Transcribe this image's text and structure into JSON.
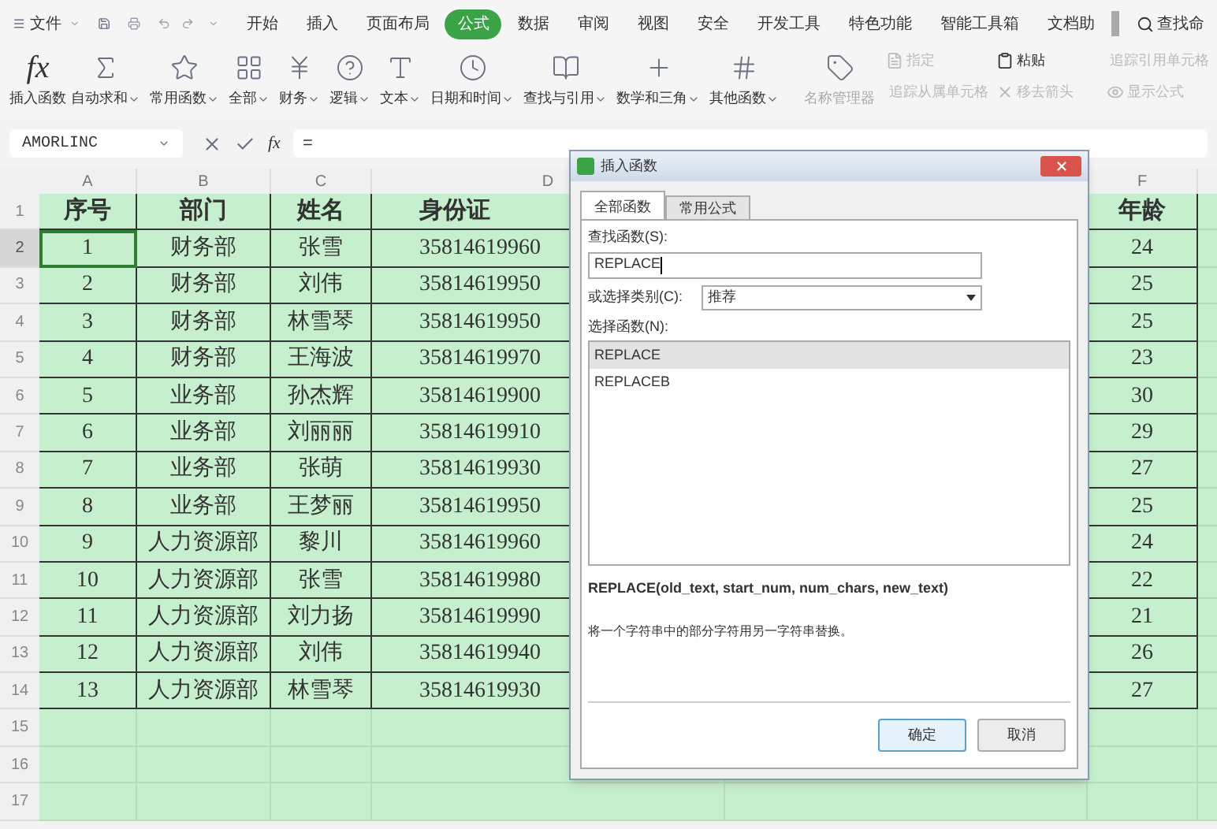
{
  "menu_bar": {
    "file_menu": "文件",
    "tabs": [
      {
        "label": "开始",
        "selected": false
      },
      {
        "label": "插入",
        "selected": false
      },
      {
        "label": "页面布局",
        "selected": false
      },
      {
        "label": "公式",
        "selected": true
      },
      {
        "label": "数据",
        "selected": false
      },
      {
        "label": "审阅",
        "selected": false
      },
      {
        "label": "视图",
        "selected": false
      },
      {
        "label": "安全",
        "selected": false
      },
      {
        "label": "开发工具",
        "selected": false
      },
      {
        "label": "特色功能",
        "selected": false
      },
      {
        "label": "智能工具箱",
        "selected": false
      },
      {
        "label": "文档助",
        "selected": false
      }
    ],
    "search": "查找命"
  },
  "ribbon": {
    "insert_function": {
      "icon_text": "fx",
      "label": "插入函数"
    },
    "buttons": [
      {
        "label": "自动求和",
        "dropdown": true
      },
      {
        "label": "常用函数",
        "dropdown": true
      },
      {
        "label": "全部",
        "dropdown": true
      },
      {
        "label": "财务",
        "dropdown": true
      },
      {
        "label": "逻辑",
        "dropdown": true
      },
      {
        "label": "文本",
        "dropdown": true
      },
      {
        "label": "日期和时间",
        "dropdown": true
      },
      {
        "label": "查找与引用",
        "dropdown": true
      },
      {
        "label": "数学和三角",
        "dropdown": true
      },
      {
        "label": "其他函数",
        "dropdown": true
      },
      {
        "label": "名称管理器",
        "dropdown": false
      }
    ],
    "small_buttons": [
      {
        "label": "指定",
        "disabled": true
      },
      {
        "label": "粘贴",
        "disabled": false
      },
      {
        "label": "追踪引用单元格",
        "disabled": true
      },
      {
        "label": "追踪从属单元格",
        "disabled": true
      },
      {
        "label": "移去箭头",
        "disabled": true
      },
      {
        "label": "显示公式",
        "disabled": true
      }
    ]
  },
  "formula_bar": {
    "name_box": "AMORLINC",
    "fx": "fx",
    "formula": "="
  },
  "sheet": {
    "columns": [
      "A",
      "B",
      "C",
      "D",
      "F"
    ],
    "rows": [
      {
        "number": "1",
        "selected": false,
        "cells": [
          "序号",
          "部门",
          "姓名",
          "身份证",
          "年龄"
        ]
      },
      {
        "number": "2",
        "selected": true,
        "cells": [
          "1",
          "财务部",
          "张雪",
          "35814619960",
          "24"
        ]
      },
      {
        "number": "3",
        "selected": false,
        "cells": [
          "2",
          "财务部",
          "刘伟",
          "35814619950",
          "25"
        ]
      },
      {
        "number": "4",
        "selected": false,
        "cells": [
          "3",
          "财务部",
          "林雪琴",
          "35814619950",
          "25"
        ]
      },
      {
        "number": "5",
        "selected": false,
        "cells": [
          "4",
          "财务部",
          "王海波",
          "35814619970",
          "23"
        ]
      },
      {
        "number": "6",
        "selected": false,
        "cells": [
          "5",
          "业务部",
          "孙杰辉",
          "35814619900",
          "30"
        ]
      },
      {
        "number": "7",
        "selected": false,
        "cells": [
          "6",
          "业务部",
          "刘丽丽",
          "35814619910",
          "29"
        ]
      },
      {
        "number": "8",
        "selected": false,
        "cells": [
          "7",
          "业务部",
          "张萌",
          "35814619930",
          "27"
        ]
      },
      {
        "number": "9",
        "selected": false,
        "cells": [
          "8",
          "业务部",
          "王梦丽",
          "35814619950",
          "25"
        ]
      },
      {
        "number": "10",
        "selected": false,
        "cells": [
          "9",
          "人力资源部",
          "黎川",
          "35814619960",
          "24"
        ]
      },
      {
        "number": "11",
        "selected": false,
        "cells": [
          "10",
          "人力资源部",
          "张雪",
          "35814619980",
          "22"
        ]
      },
      {
        "number": "12",
        "selected": false,
        "cells": [
          "11",
          "人力资源部",
          "刘力扬",
          "35814619990",
          "21"
        ]
      },
      {
        "number": "13",
        "selected": false,
        "cells": [
          "12",
          "人力资源部",
          "刘伟",
          "35814619940",
          "26"
        ]
      },
      {
        "number": "14",
        "selected": false,
        "cells": [
          "13",
          "人力资源部",
          "林雪琴",
          "35814619930",
          "27"
        ]
      },
      {
        "number": "15",
        "selected": false,
        "cells": []
      },
      {
        "number": "16",
        "selected": false,
        "cells": []
      },
      {
        "number": "17",
        "selected": false,
        "cells": []
      }
    ]
  },
  "dialog": {
    "title": "插入函数",
    "tabs": [
      {
        "label": "全部函数",
        "selected": true
      },
      {
        "label": "常用公式",
        "selected": false
      }
    ],
    "search_label": "查找函数(S):",
    "search_value": "REPLACE",
    "category_label": "或选择类别(C):",
    "category_value": "推荐",
    "list_label": "选择函数(N):",
    "functions": [
      {
        "name": "REPLACE",
        "selected": true
      },
      {
        "name": "REPLACEB",
        "selected": false
      }
    ],
    "signature": "REPLACE(old_text, start_num, num_chars, new_text)",
    "description": "将一个字符串中的部分字符用另一字符串替换。",
    "buttons": [
      "确定",
      "取消"
    ]
  }
}
